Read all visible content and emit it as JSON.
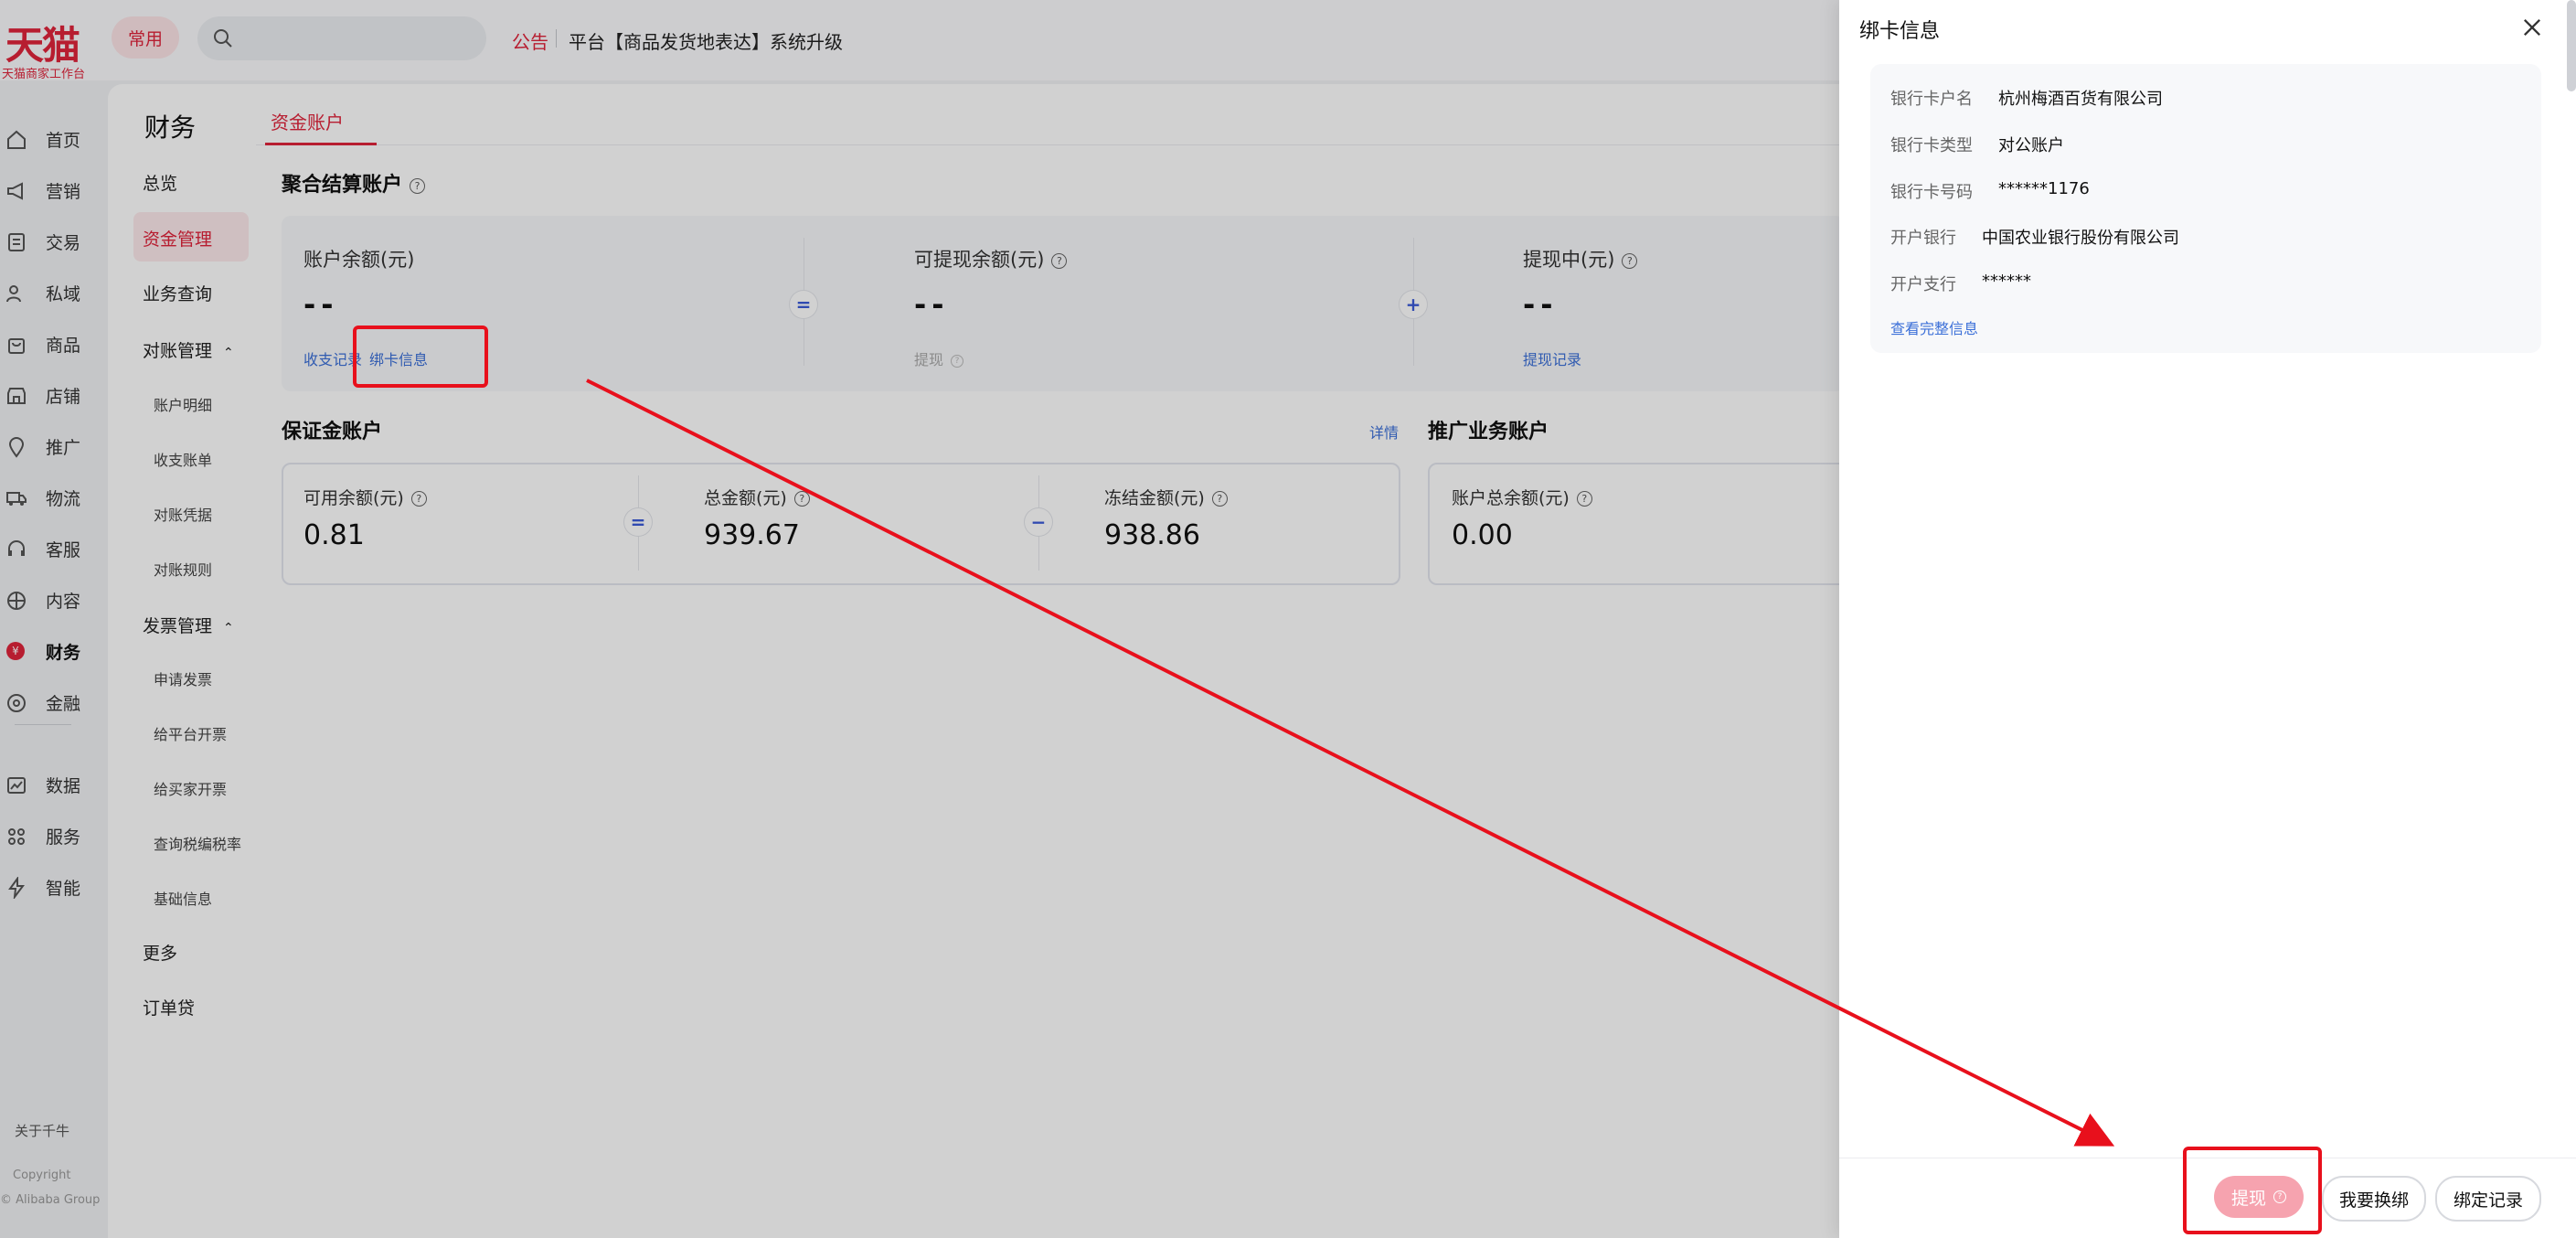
{
  "topbar": {
    "logo": "天猫",
    "logo_sub": "天猫商家工作台",
    "favorites_label": "常用",
    "search_placeholder": "",
    "notice_tag": "公告",
    "notice_text": "平台【商品发货地表达】系统升级"
  },
  "leftnav": {
    "items": [
      {
        "label": "首页",
        "icon": "home-icon"
      },
      {
        "label": "营销",
        "icon": "megaphone-icon"
      },
      {
        "label": "交易",
        "icon": "receipt-icon"
      },
      {
        "label": "私域",
        "icon": "users-icon"
      },
      {
        "label": "商品",
        "icon": "bag-icon"
      },
      {
        "label": "店铺",
        "icon": "store-icon"
      },
      {
        "label": "推广",
        "icon": "pin-icon"
      },
      {
        "label": "物流",
        "icon": "truck-icon"
      },
      {
        "label": "客服",
        "icon": "headset-icon"
      },
      {
        "label": "内容",
        "icon": "grid-icon"
      },
      {
        "label": "财务",
        "icon": "yuan-icon",
        "active": true
      },
      {
        "label": "金融",
        "icon": "target-icon"
      },
      {
        "label": "数据",
        "icon": "chart-icon"
      },
      {
        "label": "服务",
        "icon": "apps-icon"
      },
      {
        "label": "智能",
        "icon": "bolt-icon"
      }
    ],
    "about": "关于千牛",
    "copyright_line1": "Copyright",
    "copyright_line2": "© Alibaba Group"
  },
  "finance_menu": {
    "title": "财务",
    "overview": "总览",
    "fund_management": "资金管理",
    "business_query": "业务查询",
    "reconciliation": "对账管理",
    "reconciliation_children": [
      "账户明细",
      "收支账单",
      "对账凭据",
      "对账规则"
    ],
    "invoice": "发票管理",
    "invoice_children": [
      "申请发票",
      "给平台开票",
      "给买家开票",
      "查询税编税率",
      "基础信息"
    ],
    "more": "更多",
    "order_loan": "订单贷"
  },
  "main": {
    "tab_active": "资金账户",
    "aggregate_title": "聚合结算账户",
    "balance_label": "账户余额(元)",
    "balance_value": "--",
    "income_record_link": "收支记录",
    "bind_card_link": "绑卡信息",
    "op_equals": "=",
    "withdrawable_label": "可提现余额(元)",
    "withdrawable_value": "--",
    "withdraw_link": "提现",
    "op_plus": "+",
    "withdrawing_label": "提现中(元)",
    "withdrawing_value": "--",
    "withdraw_record_link": "提现记录",
    "deposit_title": "保证金账户",
    "deposit_detail_link": "详情",
    "available_label": "可用余额(元)",
    "available_value": "0.81",
    "op_equals2": "=",
    "total_label": "总金额(元)",
    "total_value": "939.67",
    "op_minus": "−",
    "frozen_label": "冻结金额(元)",
    "frozen_value": "938.86",
    "promo_title": "推广业务账户",
    "promo_balance_label": "账户总余额(元)",
    "promo_balance_value": "0.00"
  },
  "drawer": {
    "title": "绑卡信息",
    "fields": [
      {
        "label": "银行卡户名",
        "value": "杭州梅酒百货有限公司"
      },
      {
        "label": "银行卡类型",
        "value": "对公账户"
      },
      {
        "label": "银行卡号码",
        "value": "******1176"
      },
      {
        "label": "开户银行",
        "value": "中国农业银行股份有限公司"
      },
      {
        "label": "开户支行",
        "value": "******"
      }
    ],
    "view_full_link": "查看完整信息",
    "btn_withdraw": "提现",
    "btn_rebind": "我要换绑",
    "btn_record": "绑定记录"
  },
  "colors": {
    "brand_red": "#e0243b",
    "link_blue": "#3b6fd8",
    "annotation_red": "#e8101c"
  }
}
